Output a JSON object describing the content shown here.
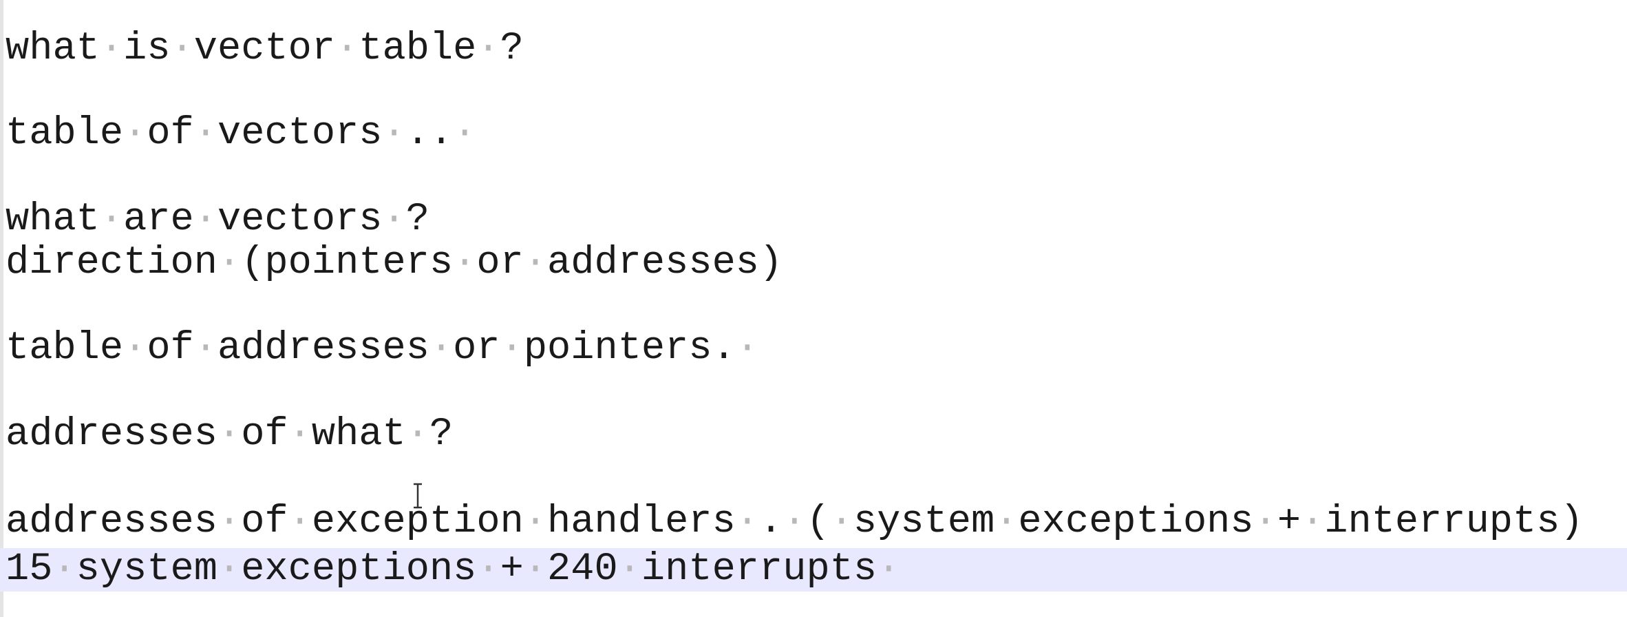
{
  "editor": {
    "lines": [
      "what is vector table ?",
      "table of vectors .. ",
      "what are vectors ?",
      "direction (pointers or addresses)",
      "table of addresses or pointers. ",
      "addresses of what ?",
      "addresses of exception handlers . ( system exceptions + interrupts)",
      "15 system exceptions + 240 interrupts "
    ],
    "current_line_index": 7,
    "colors": {
      "background": "#ffffff",
      "text": "#1a1a1a",
      "whitespace_dot": "#b8b8b8",
      "current_line_highlight": "#e8e8ff"
    },
    "cursor_icon": "text-cursor-ibeam-icon"
  }
}
